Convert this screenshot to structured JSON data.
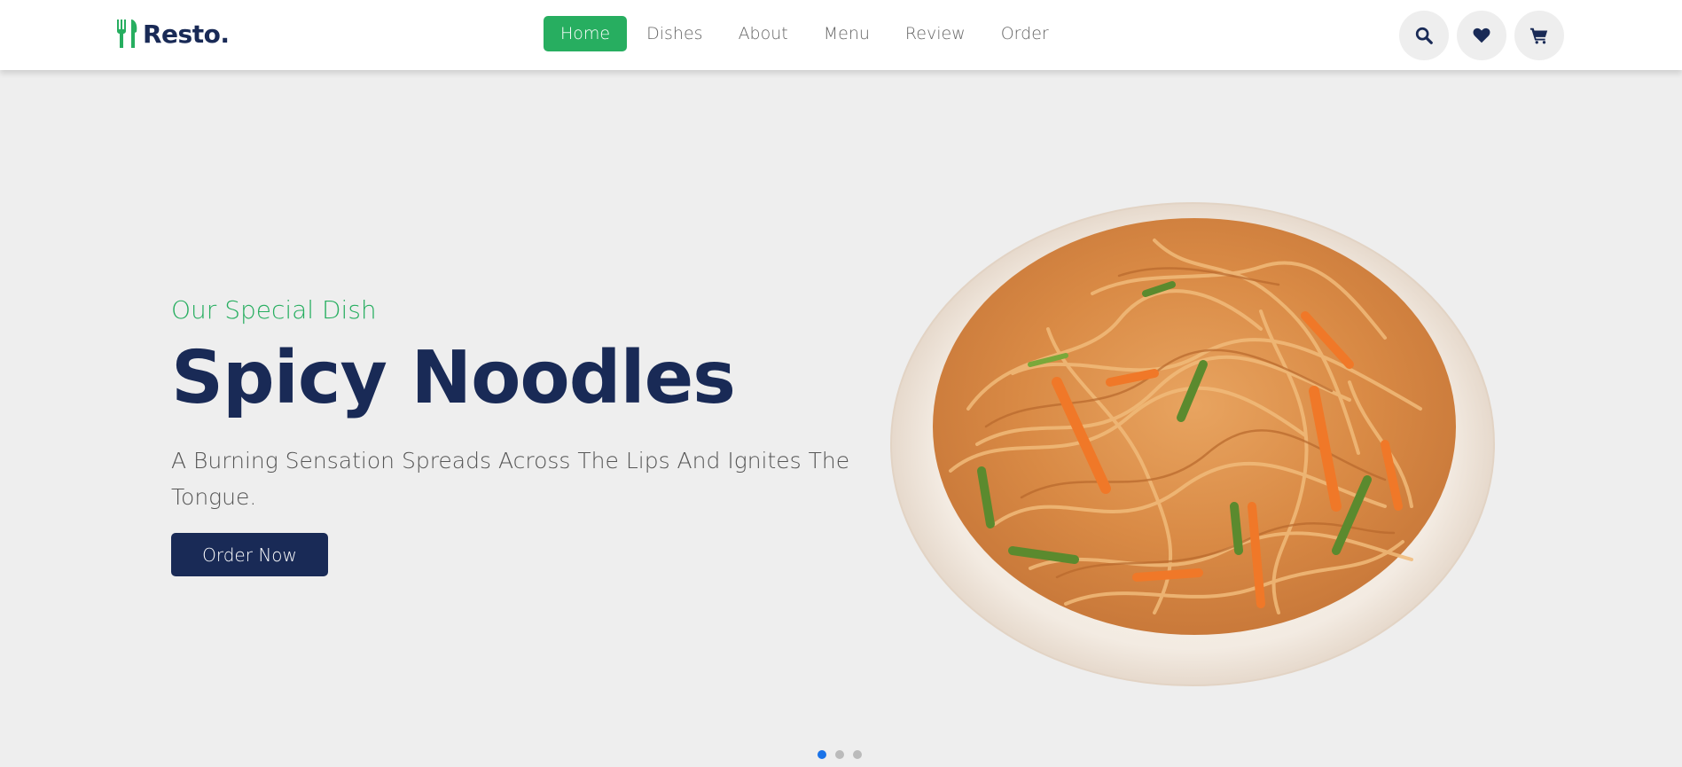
{
  "header": {
    "logo_text": "Resto.",
    "nav": [
      {
        "label": "Home",
        "active": true
      },
      {
        "label": "Dishes",
        "active": false
      },
      {
        "label": "About",
        "active": false
      },
      {
        "label": "Menu",
        "active": false
      },
      {
        "label": "Review",
        "active": false
      },
      {
        "label": "Order",
        "active": false
      }
    ],
    "icons": [
      "search-icon",
      "heart-icon",
      "cart-icon"
    ]
  },
  "hero": {
    "subtitle": "Our Special Dish",
    "title": "Spicy Noodles",
    "description": "A Burning Sensation Spreads Across The Lips And Ignites The Tongue.",
    "button_label": "Order Now",
    "image": "spicy-noodles-plate",
    "slides": 3,
    "active_slide": 1
  },
  "colors": {
    "accent": "#27ae60",
    "primary": "#192a56",
    "hero_bg": "#eeeeee",
    "dot_active": "#1a73e8"
  }
}
